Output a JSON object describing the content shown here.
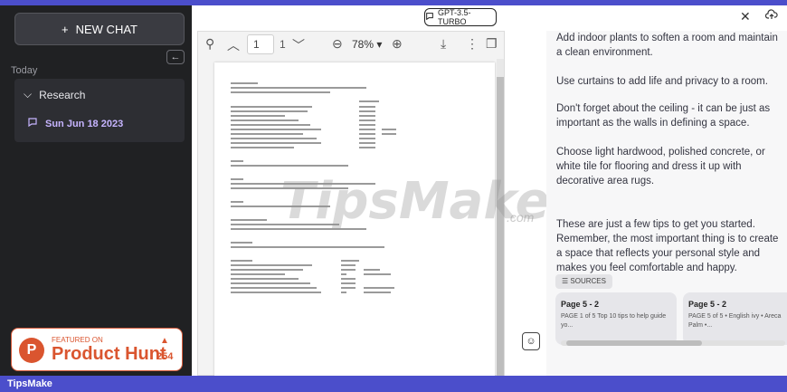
{
  "sidebar": {
    "new_chat_label": "NEW CHAT",
    "new_chat_icon": "plus-icon",
    "collapse_icon": "arrow-left-icon",
    "section_label": "Today",
    "folder_label": "Research",
    "chat_item_label": "Sun Jun 18 2023",
    "product_hunt": {
      "small_text": "FEATURED ON",
      "big_text": "Product Hunt",
      "count": "254"
    }
  },
  "pdf": {
    "page_value": "1",
    "page_total": "1",
    "zoom": "78%"
  },
  "model": {
    "label": "GPT-3.5-TURBO"
  },
  "chat": {
    "paragraphs": [
      "Add indoor plants to soften a room and maintain a clean environment.",
      "Use curtains to add life and privacy to a room.",
      "Don't forget about the ceiling - it can be just as important as the walls in defining a space.",
      "Choose light hardwood, polished concrete, or white tile for flooring and dress it up with decorative area rugs.",
      "These are just a few tips to get you started. Remember, the most important thing is to create a space that reflects your personal style and makes you feel comfortable and happy."
    ],
    "sources_label": "SOURCES",
    "sources": [
      {
        "title": "Page 5 - 2",
        "body": "PAGE 1 of 5 Top 10 tips to help guide yo..."
      },
      {
        "title": "Page 5 - 2",
        "body": "PAGE 5 of 5 • English ivy • Areca Palm •..."
      }
    ]
  },
  "watermark": {
    "main": "TipsMake",
    "suffix": ".com"
  },
  "footer": {
    "label": "TipsMake"
  },
  "colors": {
    "accent": "#4b4ecb",
    "sidebar_bg": "#202123",
    "product_hunt": "#da552f"
  }
}
